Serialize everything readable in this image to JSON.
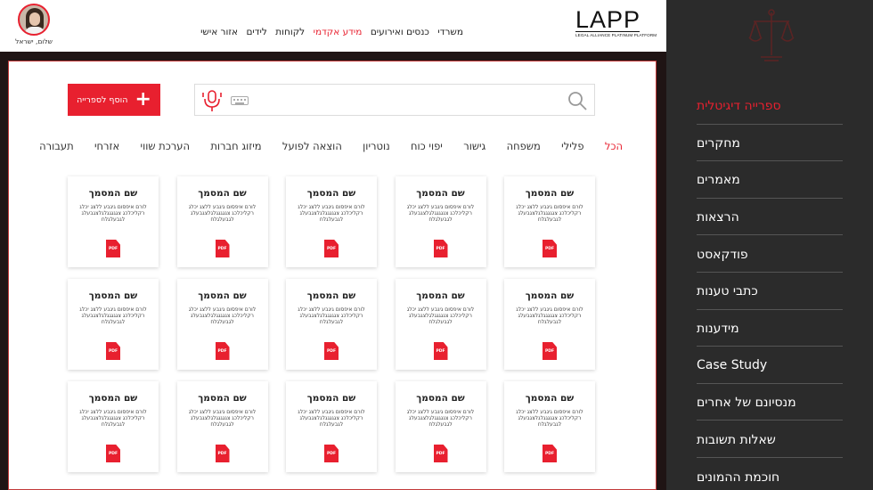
{
  "header": {
    "logo_text": "LAPP",
    "logo_tagline": "LEGAL ALLIANCE PLATINUM PLATFORM",
    "nav": [
      {
        "label": "משרדי",
        "active": false
      },
      {
        "label": "כנסים ואירועים",
        "active": false
      },
      {
        "label": "מידע אקדמי",
        "active": true
      },
      {
        "label": "לקוחות",
        "active": false
      },
      {
        "label": "לידים",
        "active": false
      },
      {
        "label": "אזור אישי",
        "active": false
      }
    ],
    "greeting": "שלום, ישראל"
  },
  "sidebar": {
    "items": [
      {
        "label": "ספרייה דיגיטלית",
        "active": true
      },
      {
        "label": "מחקרים",
        "active": false
      },
      {
        "label": "מאמרים",
        "active": false
      },
      {
        "label": "הרצאות",
        "active": false
      },
      {
        "label": "פודקאסט",
        "active": false
      },
      {
        "label": "כתבי טענות",
        "active": false
      },
      {
        "label": "מידענות",
        "active": false
      },
      {
        "label": "Case Study",
        "active": false
      },
      {
        "label": "מנסיונם של אחרים",
        "active": false
      },
      {
        "label": "שאלות תשובות",
        "active": false
      },
      {
        "label": "חוכמת ההמונים",
        "active": false
      }
    ]
  },
  "toolbar": {
    "add_label": "הוסף לספרייה",
    "search_placeholder": ""
  },
  "categories": [
    {
      "label": "הכל",
      "active": true
    },
    {
      "label": "פלילי",
      "active": false
    },
    {
      "label": "משפחה",
      "active": false
    },
    {
      "label": "גישור",
      "active": false
    },
    {
      "label": "יפוי כוח",
      "active": false
    },
    {
      "label": "נוטריון",
      "active": false
    },
    {
      "label": "הוצאה לפועל",
      "active": false
    },
    {
      "label": "מיזוג חברות",
      "active": false
    },
    {
      "label": "הערכת שווי",
      "active": false
    },
    {
      "label": "אזרחי",
      "active": false
    },
    {
      "label": "תעבורה",
      "active": false
    }
  ],
  "documents": [
    {
      "title": "שם המסמך",
      "desc": "לורם איפסום גיגבע ללצג יכלג רקליכלכג צגגגגגלגלצגבעלג לגבעלגלח",
      "badge": "PDF"
    },
    {
      "title": "שם המסמך",
      "desc": "לורם איפסום גיגבע ללצג יכלג רקליכלכג צגגגגגלגלצגבעלג לגבעלגלח",
      "badge": "PDF"
    },
    {
      "title": "שם המסמך",
      "desc": "לורם איפסום גיגבע ללצג יכלג רקליכלכג צגגגגגלגלצגבעלג לגבעלגלח",
      "badge": "PDF"
    },
    {
      "title": "שם המסמך",
      "desc": "לורם איפסום גיגבע ללצג יכלג רקליכלכג צגגגגגלגלצגבעלג לגבעלגלח",
      "badge": "PDF"
    },
    {
      "title": "שם המסמך",
      "desc": "לורם איפסום גיגבע ללצג יכלג רקליכלכג צגגגגגלגלצגבעלג לגבעלגלח",
      "badge": "PDF"
    },
    {
      "title": "שם המסמך",
      "desc": "לורם איפסום גיגבע ללצג יכלג רקליכלכג צגגגגגלגלצגבעלג לגבעלגלח",
      "badge": "PDF"
    },
    {
      "title": "שם המסמך",
      "desc": "לורם איפסום גיגבע ללצג יכלג רקליכלכג צגגגגגלגלצגבעלג לגבעלגלח",
      "badge": "PDF"
    },
    {
      "title": "שם המסמך",
      "desc": "לורם איפסום גיגבע ללצג יכלג רקליכלכג צגגגגגלגלצגבעלג לגבעלגלח",
      "badge": "PDF"
    },
    {
      "title": "שם המסמך",
      "desc": "לורם איפסום גיגבע ללצג יכלג רקליכלכג צגגגגגלגלצגבעלג לגבעלגלח",
      "badge": "PDF"
    },
    {
      "title": "שם המסמך",
      "desc": "לורם איפסום גיגבע ללצג יכלג רקליכלכג צגגגגגלגלצגבעלג לגבעלגלח",
      "badge": "PDF"
    },
    {
      "title": "שם המסמך",
      "desc": "לורם איפסום גיגבע ללצג יכלג רקליכלכג צגגגגגלגלצגבעלג לגבעלגלח",
      "badge": "PDF"
    },
    {
      "title": "שם המסמך",
      "desc": "לורם איפסום גיגבע ללצג יכלג רקליכלכג צגגגגגלגלצגבעלג לגבעלגלח",
      "badge": "PDF"
    },
    {
      "title": "שם המסמך",
      "desc": "לורם איפסום גיגבע ללצג יכלג רקליכלכג צגגגגגלגלצגבעלג לגבעלגלח",
      "badge": "PDF"
    },
    {
      "title": "שם המסמך",
      "desc": "לורם איפסום גיגבע ללצג יכלג רקליכלכג צגגגגגלגלצגבעלג לגבעלגלח",
      "badge": "PDF"
    },
    {
      "title": "שם המסמך",
      "desc": "לורם איפסום גיגבע ללצג יכלג רקליכלכג צגגגגגלגלצגבעלג לגבעלגלח",
      "badge": "PDF"
    }
  ],
  "colors": {
    "accent": "#e8202f",
    "sidebar_bg": "#2b2b2b",
    "page_bg": "#1f1414"
  },
  "icons": {
    "sidebar_logo": "scales-of-justice-icon",
    "add": "plus-icon",
    "voice": "microphone-icon",
    "keyboard": "keyboard-icon",
    "search": "magnifier-icon",
    "document": "pdf-file-icon"
  }
}
